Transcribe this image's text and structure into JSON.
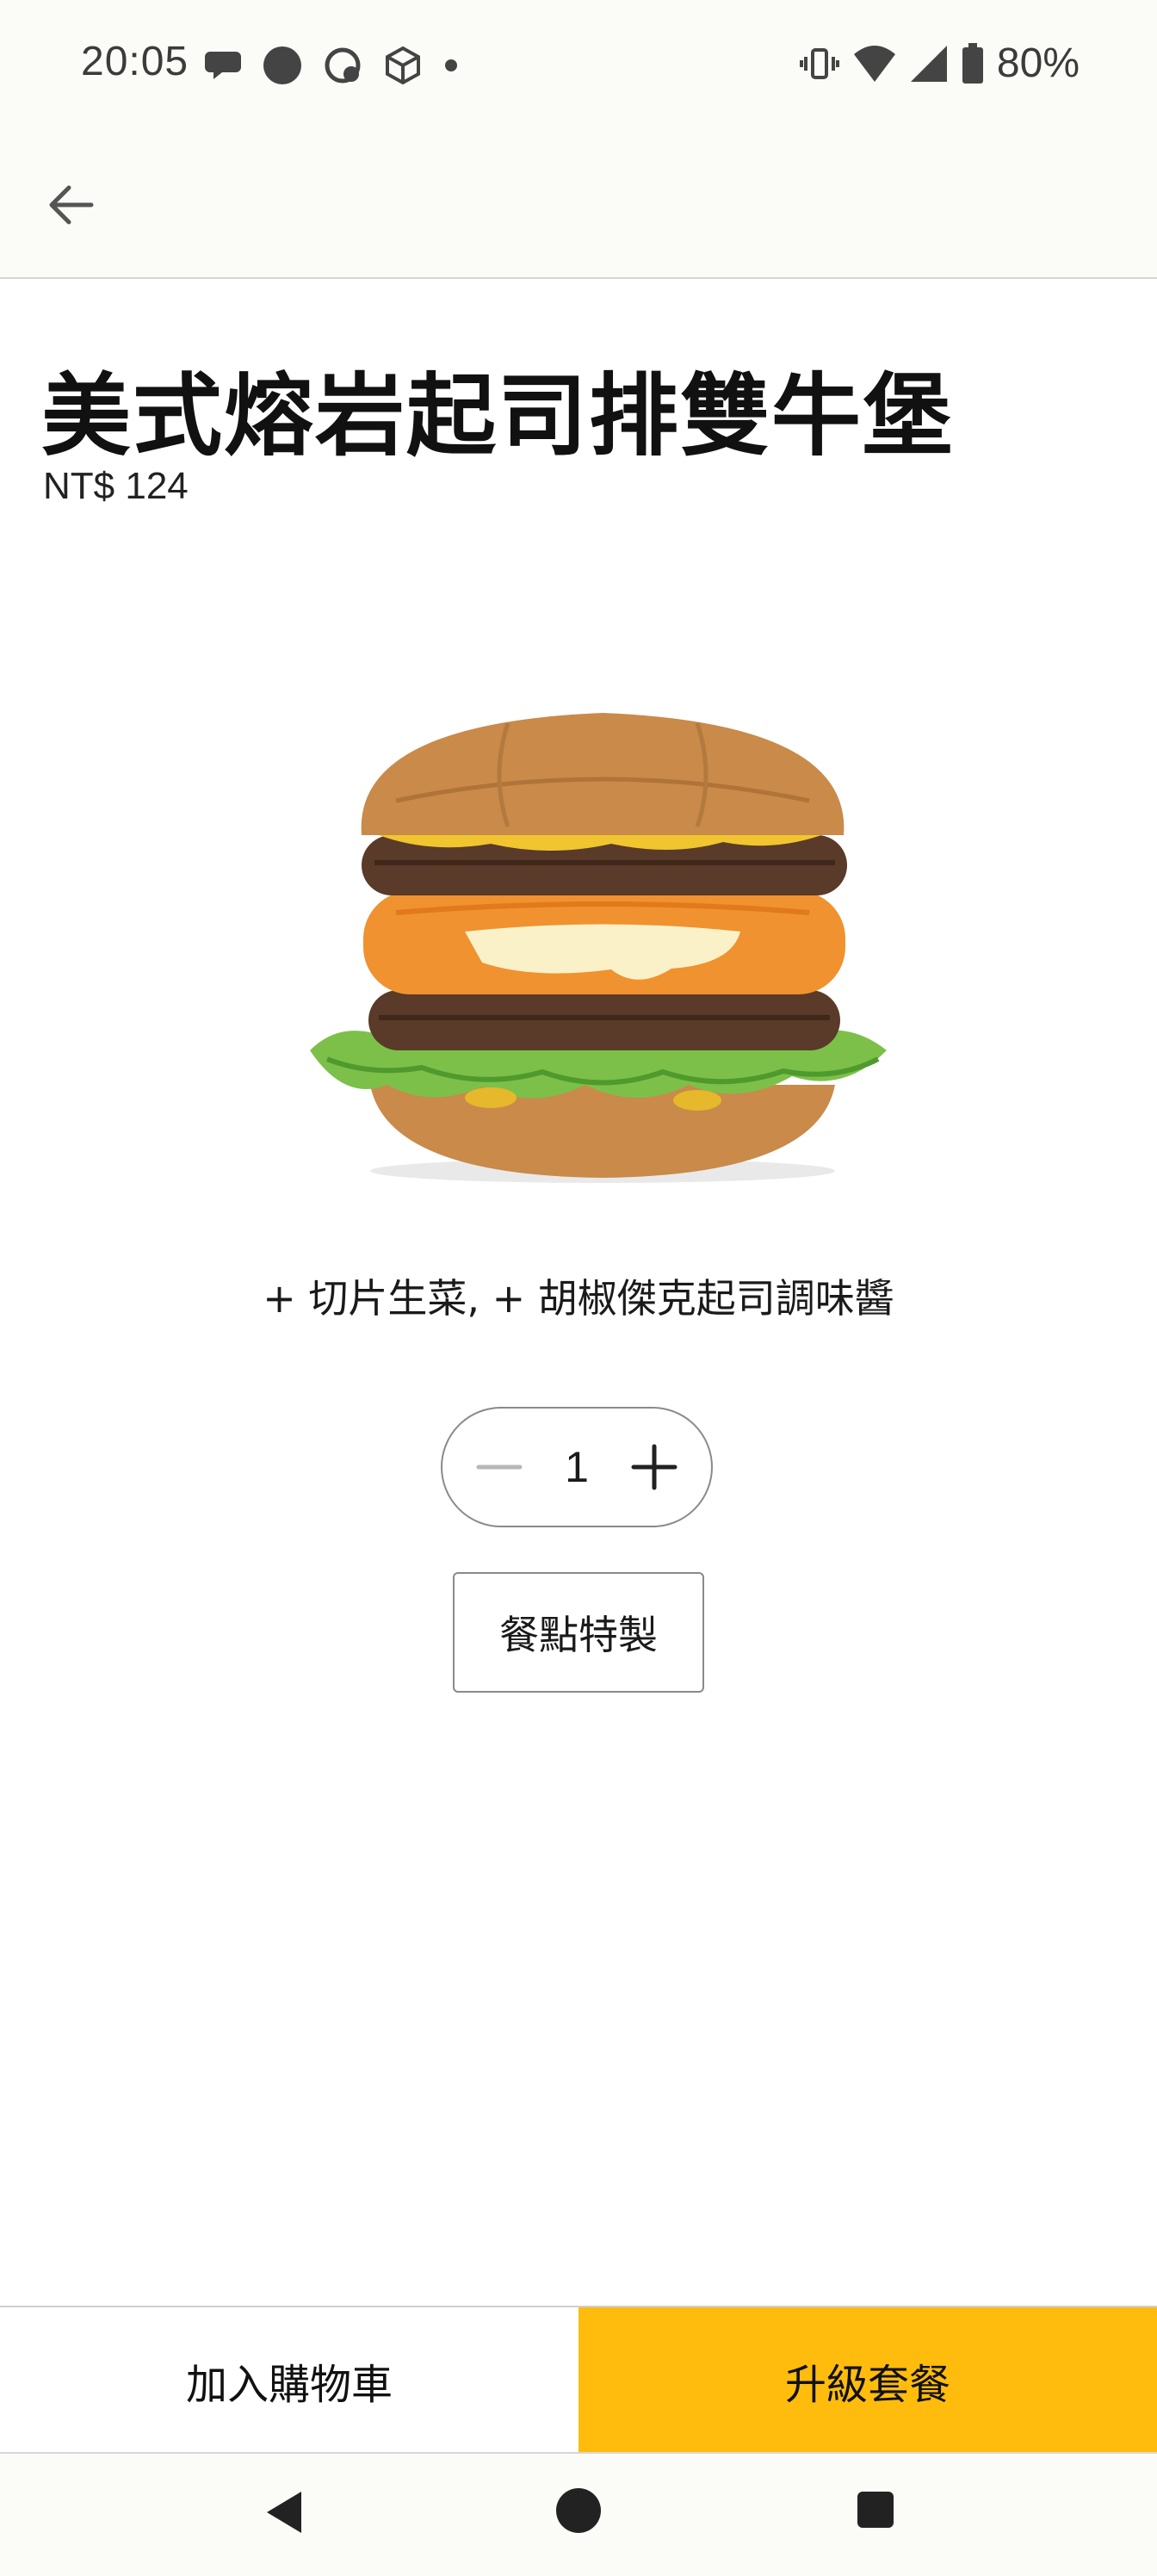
{
  "status_bar": {
    "time": "20:05",
    "battery": "80%",
    "left_icons": [
      "message-icon",
      "circle-icon",
      "clock-badge-icon",
      "cube-icon",
      "dot-icon"
    ],
    "right_icons": [
      "vibrate-icon",
      "wifi-icon",
      "signal-icon",
      "battery-icon"
    ]
  },
  "app_bar": {
    "back_icon": "arrow-left-icon"
  },
  "product": {
    "title": "美式熔岩起司排雙牛堡",
    "price": "NT$ 124",
    "modifiers": "+ 切片生菜, + 胡椒傑克起司調味醬",
    "image_icon": "burger-image"
  },
  "quantity": {
    "value": "1",
    "minus_icon": "minus-icon",
    "plus_icon": "plus-icon"
  },
  "customize": {
    "label": "餐點特製"
  },
  "actions": {
    "add_to_cart": "加入購物車",
    "upgrade_meal": "升級套餐",
    "accent_color": "#ffbc0d"
  },
  "nav": {
    "back_icon": "nav-back-icon",
    "home_icon": "nav-home-icon",
    "recents_icon": "nav-recents-icon"
  }
}
